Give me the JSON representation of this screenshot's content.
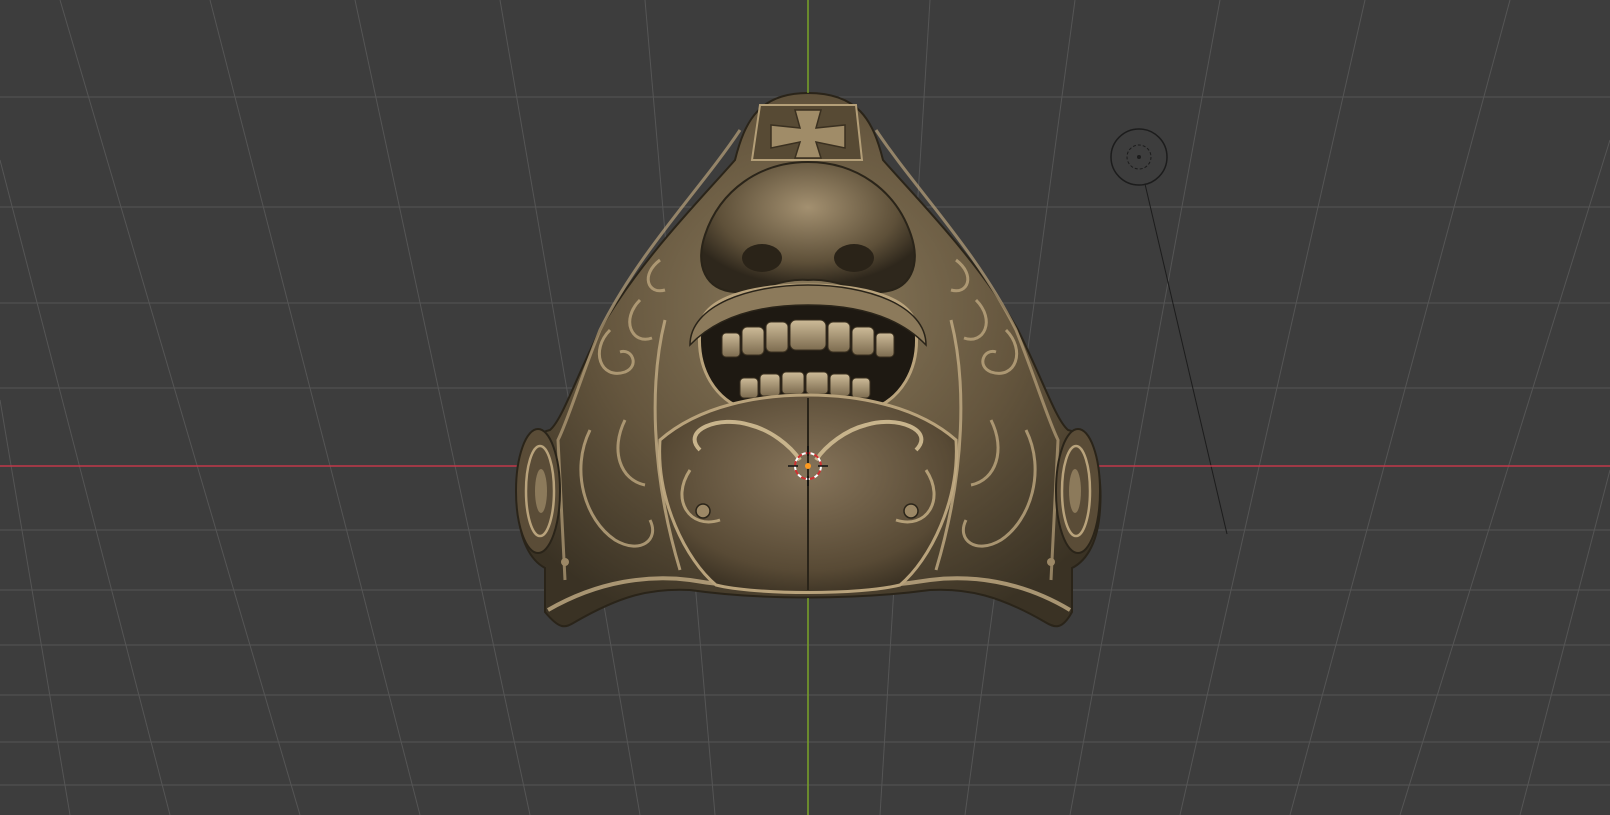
{
  "app": "3D viewport",
  "viewport": {
    "background_color": "#3d3d3d",
    "grid_color": "#555555",
    "x_axis_color": "#c8384a",
    "y_axis_color": "#7aa329",
    "grid_visible": true,
    "view": "perspective"
  },
  "scene": {
    "object": "ornate-bronze-mask",
    "object_color": "#6e5e45",
    "object_highlight_color": "#c9b58f",
    "object_shadow_color": "#2a2419"
  },
  "gizmos": {
    "origin_cursor": "3d-cursor-icon",
    "light": "light-icon"
  }
}
